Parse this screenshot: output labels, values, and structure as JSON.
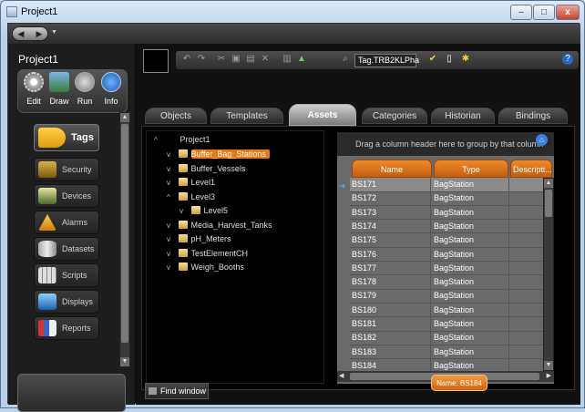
{
  "window": {
    "title": "Project1"
  },
  "left": {
    "project_title": "Project1",
    "modes": [
      {
        "label": "Edit",
        "icon": "gear-icon"
      },
      {
        "label": "Draw",
        "icon": "draw-icon"
      },
      {
        "label": "Run",
        "icon": "play-icon"
      },
      {
        "label": "Info",
        "icon": "info-icon"
      }
    ],
    "items": [
      {
        "label": "Tags",
        "icon": "tag-icon"
      },
      {
        "label": "Security",
        "icon": "lock-icon"
      },
      {
        "label": "Devices",
        "icon": "device-icon"
      },
      {
        "label": "Alarms",
        "icon": "warning-icon"
      },
      {
        "label": "Datasets",
        "icon": "database-icon"
      },
      {
        "label": "Scripts",
        "icon": "calculator-icon"
      },
      {
        "label": "Displays",
        "icon": "display-icon"
      },
      {
        "label": "Reports",
        "icon": "report-icon"
      }
    ]
  },
  "toolbar": {
    "tag_box": "Tag.TRB2KLPha"
  },
  "tabs": [
    "Objects",
    "Templates",
    "Assets",
    "Categories",
    "Historian",
    "Bindings"
  ],
  "active_tab": "Assets",
  "tree": [
    {
      "label": "Project1",
      "exp": "^"
    },
    {
      "label": "Buffer_Bag_Stations",
      "exp": "v"
    },
    {
      "label": "Buffer_Vessels",
      "exp": "v"
    },
    {
      "label": "Level1",
      "exp": "v"
    },
    {
      "label": "Level3",
      "exp": "^"
    },
    {
      "label": "Level5",
      "exp": "v"
    },
    {
      "label": "Media_Harvest_Tanks",
      "exp": "v"
    },
    {
      "label": "pH_Meters",
      "exp": "v"
    },
    {
      "label": "TestElementCH",
      "exp": "v"
    },
    {
      "label": "Weigh_Booths",
      "exp": "v"
    }
  ],
  "grid": {
    "group_hint": "Drag a column header here to group by that column",
    "columns": [
      "Name",
      "Type",
      "Descripti..."
    ],
    "rows": [
      {
        "name": "BS171",
        "type": "BagStation"
      },
      {
        "name": "BS172",
        "type": "BagStation"
      },
      {
        "name": "BS173",
        "type": "BagStation"
      },
      {
        "name": "BS174",
        "type": "BagStation"
      },
      {
        "name": "BS175",
        "type": "BagStation"
      },
      {
        "name": "BS176",
        "type": "BagStation"
      },
      {
        "name": "BS177",
        "type": "BagStation"
      },
      {
        "name": "BS178",
        "type": "BagStation"
      },
      {
        "name": "BS179",
        "type": "BagStation"
      },
      {
        "name": "BS180",
        "type": "BagStation"
      },
      {
        "name": "BS181",
        "type": "BagStation"
      },
      {
        "name": "BS182",
        "type": "BagStation"
      },
      {
        "name": "BS183",
        "type": "BagStation"
      },
      {
        "name": "BS184",
        "type": "BagStation"
      }
    ],
    "tooltip": "Name: BS184"
  },
  "find_window": "Find window",
  "window_buttons": {
    "minimize": "–",
    "maximize": "□",
    "close": "x"
  }
}
